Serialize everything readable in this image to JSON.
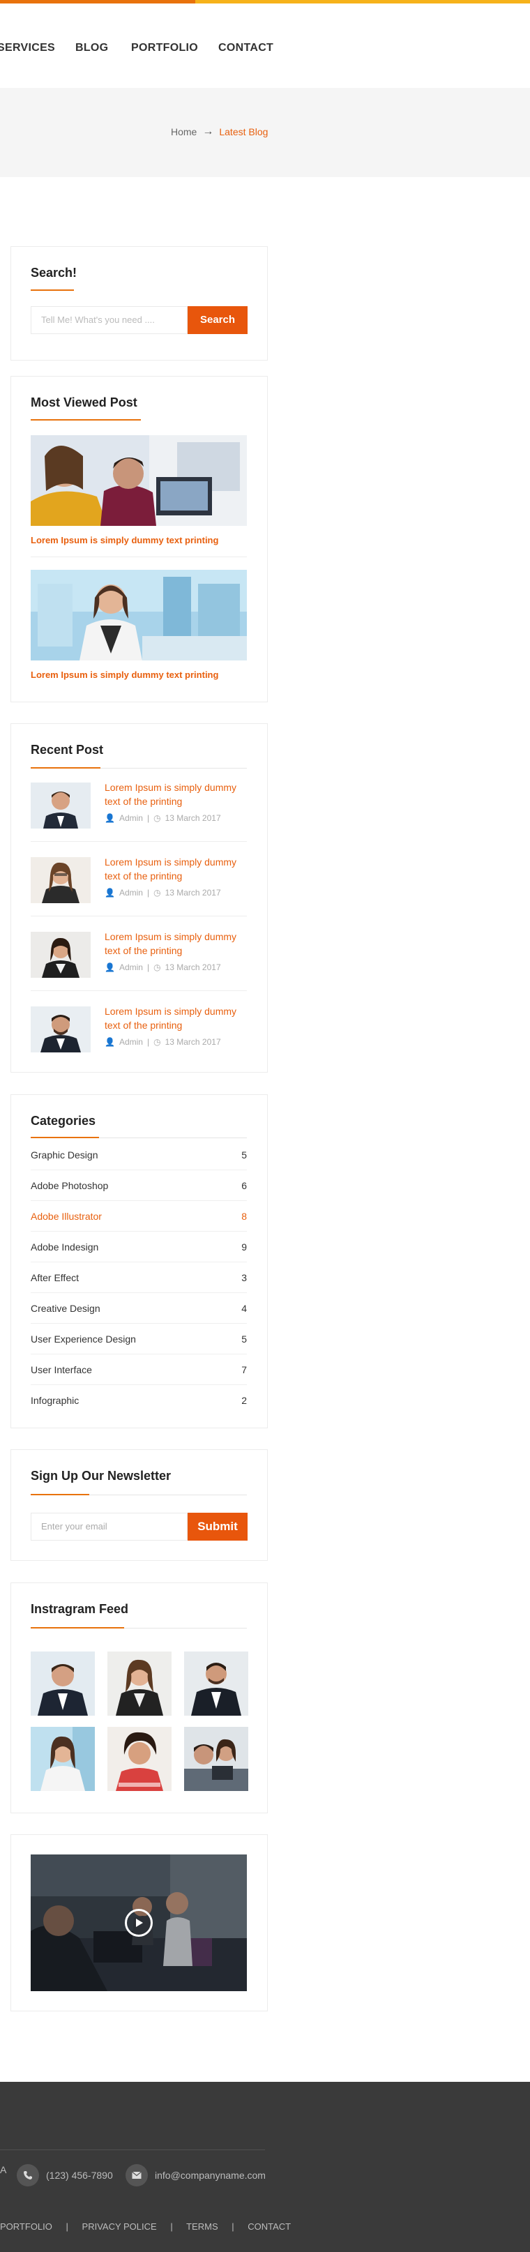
{
  "nav": {
    "items": [
      "SERVICES",
      "BLOG",
      "PORTFOLIO",
      "CONTACT"
    ]
  },
  "breadcrumb": {
    "home": "Home",
    "current": "Latest Blog"
  },
  "search": {
    "title": "Search!",
    "placeholder": "Tell Me! What's you need ....",
    "button": "Search"
  },
  "most_viewed": {
    "title": "Most Viewed Post",
    "posts": [
      {
        "caption": "Lorem Ipsum is simply dummy text printing"
      },
      {
        "caption": "Lorem Ipsum is simply dummy text  printing"
      }
    ]
  },
  "recent": {
    "title": "Recent Post",
    "posts": [
      {
        "title": "Lorem Ipsum is simply dummy text of the printing",
        "author": "Admin",
        "date": "13 March 2017"
      },
      {
        "title": "Lorem Ipsum is simply dummy text of the printing",
        "author": "Admin",
        "date": "13 March 2017"
      },
      {
        "title": "Lorem Ipsum is simply dummy text of the printing",
        "author": "Admin",
        "date": "13 March 2017"
      },
      {
        "title": "Lorem Ipsum is simply dummy text of the printing",
        "author": "Admin",
        "date": "13 March 2017"
      }
    ]
  },
  "categories": {
    "title": "Categories",
    "items": [
      {
        "name": "Graphic Design",
        "count": "5"
      },
      {
        "name": "Adobe Photoshop",
        "count": "6"
      },
      {
        "name": "Adobe Illustrator",
        "count": "8"
      },
      {
        "name": "Adobe Indesign",
        "count": "9"
      },
      {
        "name": "After Effect",
        "count": "3"
      },
      {
        "name": "Creative Design",
        "count": "4"
      },
      {
        "name": "User Experience Design",
        "count": "5"
      },
      {
        "name": "User Interface",
        "count": "7"
      },
      {
        "name": "Infographic",
        "count": "2"
      }
    ],
    "active_index": 2
  },
  "newsletter": {
    "title": "Sign Up Our Newsletter",
    "placeholder": "Enter your email",
    "button": "Submit"
  },
  "instagram": {
    "title": "Instragram Feed"
  },
  "footer": {
    "address_tail": "A",
    "phone": "(123) 456-7890",
    "email": "info@companyname.com",
    "links": [
      "PORTFOLIO",
      "PRIVACY POLICE",
      "TERMS",
      "CONTACT"
    ],
    "separator": "|"
  },
  "colors": {
    "accent": "#e8600f",
    "button": "#e8560c",
    "topbar_left": "#e8720c",
    "topbar_right": "#f6b21b",
    "footer_bg": "#3a3a3a"
  }
}
